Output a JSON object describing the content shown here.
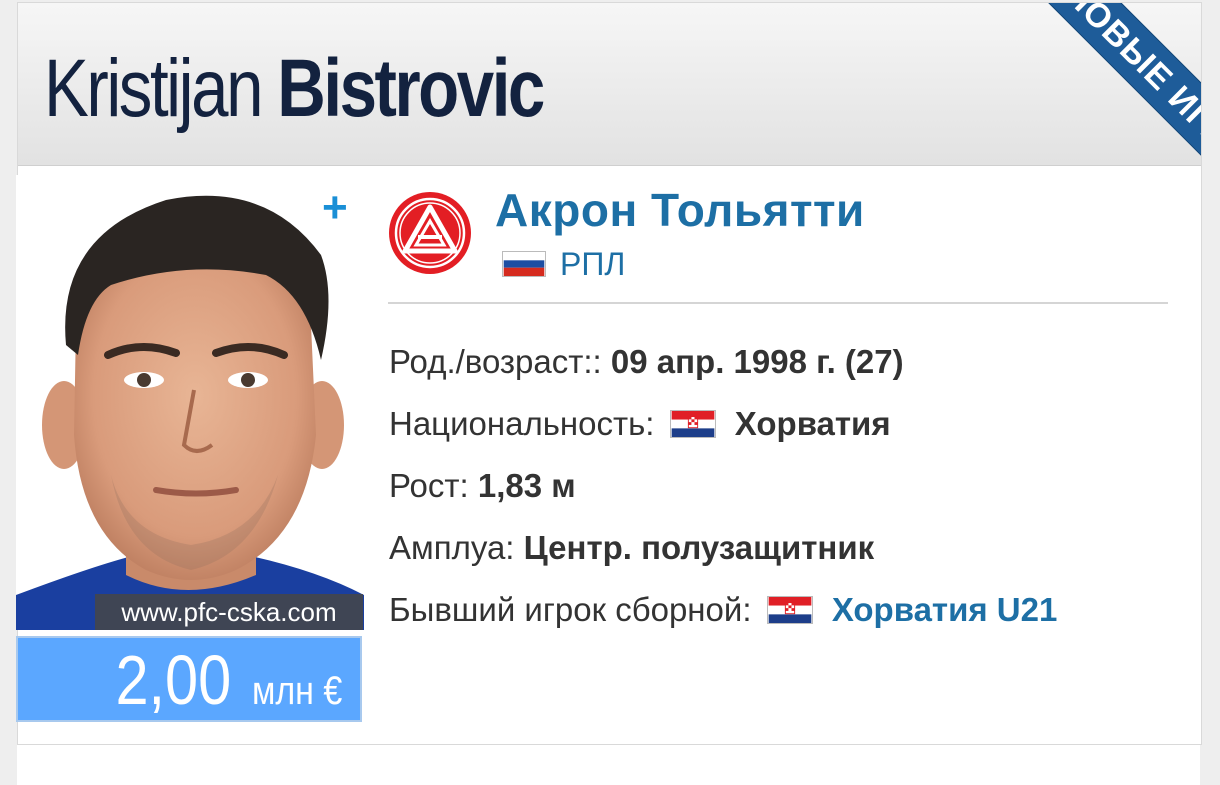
{
  "player": {
    "first_name": "Kristijan",
    "last_name": "Bistrovic"
  },
  "ribbon": {
    "label": "НОВЫЕ ИГРОКИ",
    "color": "#1e5c99"
  },
  "photo": {
    "watermark": "www.pfc-cska.com"
  },
  "market_value": {
    "amount": "2,00",
    "unit": "млн €",
    "color": "#5ba7ff"
  },
  "add_icon": "plus-icon",
  "club": {
    "name": "Акрон Тольятти",
    "league": "РПЛ",
    "league_flag": "russia-flag-icon",
    "logo": "akron-logo",
    "accent": "#1d6fa5"
  },
  "info": {
    "birth_label": "Род./возраст::",
    "birth_value": "09 апр. 1998 г. (27)",
    "nationality_label": "Национальность:",
    "nationality_value": "Хорватия",
    "height_label": "Рост:",
    "height_value": "1,83 м",
    "position_label": "Амплуа:",
    "position_value": "Центр. полузащитник",
    "national_team_label": "Бывший игрок сборной:",
    "national_team_value": "Хорватия U21"
  }
}
